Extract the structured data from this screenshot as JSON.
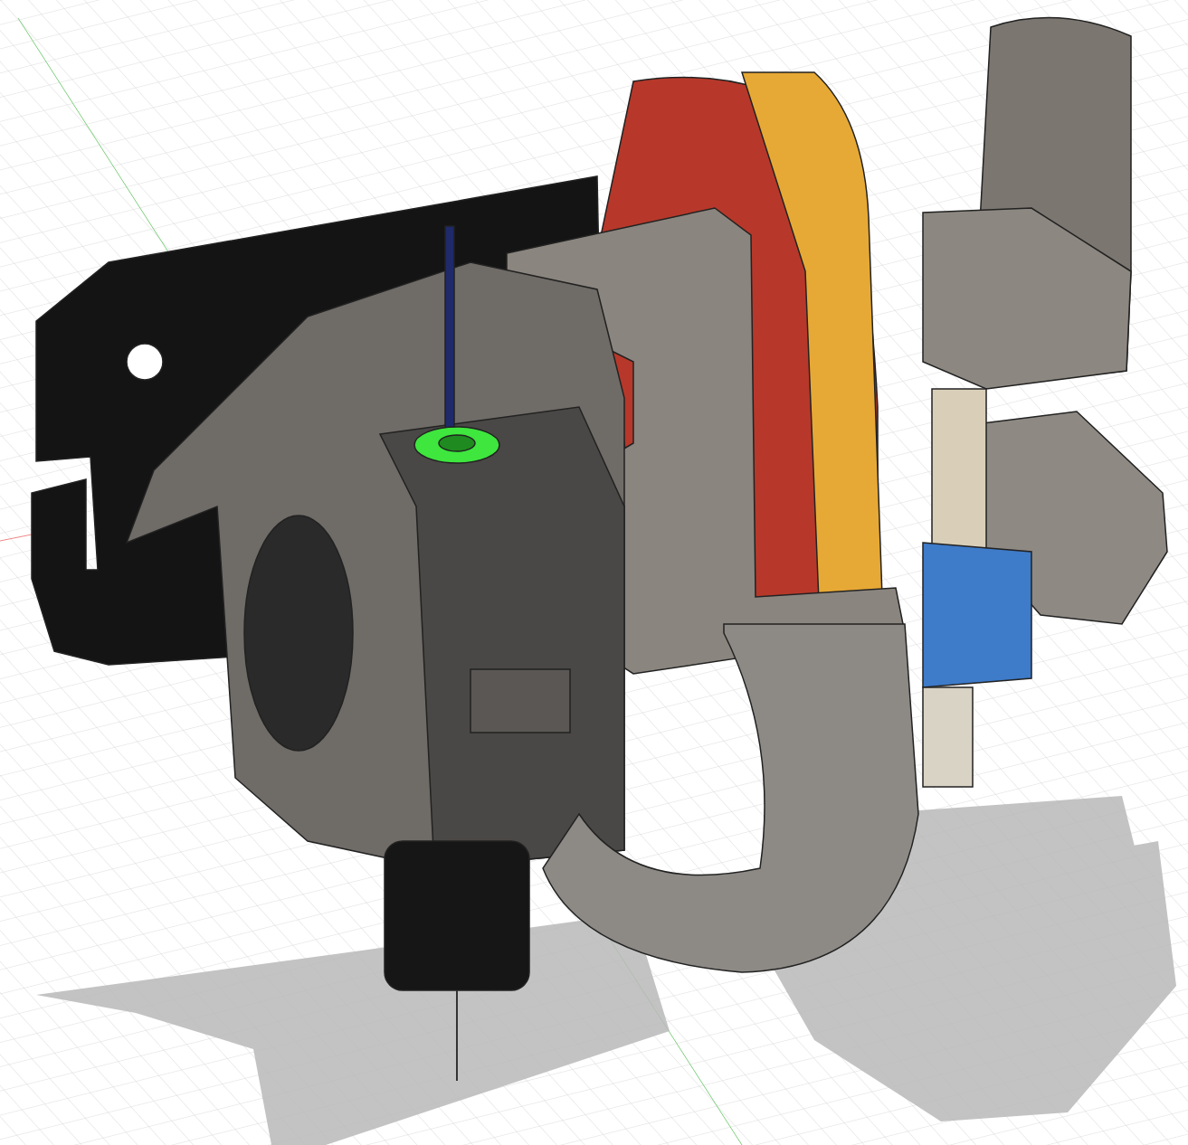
{
  "viewport": {
    "grid": true,
    "ground_shadow": true
  }
}
